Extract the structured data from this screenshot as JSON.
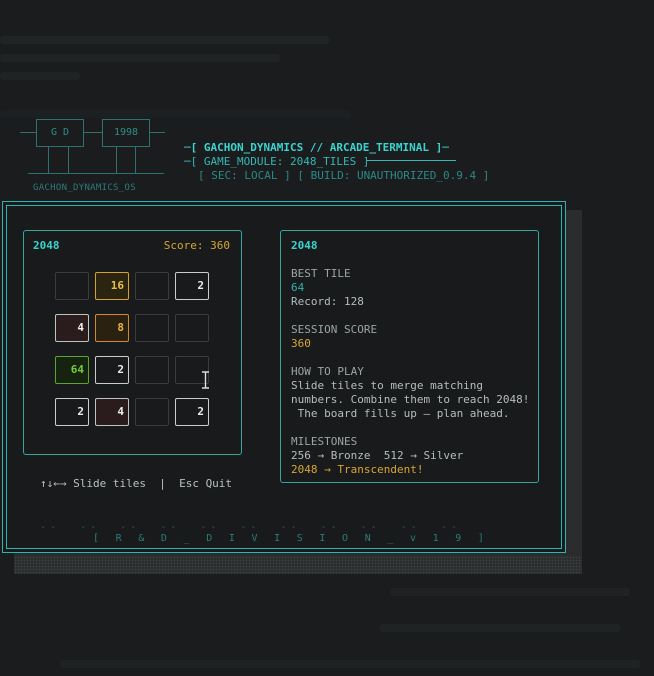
{
  "header": {
    "logo_left": "G  D",
    "logo_right": "1998",
    "logo_caption": "GACHON_DYNAMICS_OS",
    "line1": "─[ GACHON_DYNAMICS // ARCADE_TERMINAL ]─",
    "line2": "─[ GAME_MODULE: 2048_TILES ]",
    "line3": "[ SEC: LOCAL ] [ BUILD: UNAUTHORIZED_0.9.4 ]"
  },
  "game": {
    "title": "2048",
    "score_label": "Score: 360",
    "board": [
      [
        "",
        "16",
        "",
        "2"
      ],
      [
        "4",
        "8",
        "",
        ""
      ],
      [
        "64",
        "2",
        "",
        ""
      ],
      [
        "2",
        "4",
        "",
        "2"
      ]
    ],
    "controls": "↑↓←→ Slide tiles  |  Esc Quit"
  },
  "info": {
    "title": "2048",
    "best_tile_label": "BEST TILE",
    "best_tile_value": "64",
    "record": "Record: 128",
    "session_label": "SESSION SCORE",
    "session_value": "360",
    "how_label": "HOW TO PLAY",
    "how_1": "Slide tiles to merge matching",
    "how_2": "numbers. Combine them to reach 2048!",
    "how_3": " The board fills up — plan ahead.",
    "milestones_label": "MILESTONES",
    "milestone_1": "256 → Bronze  512 → Silver",
    "milestone_2": "2048 → Transcendent!"
  },
  "footer": {
    "dashes": "--  --  --  --  --  --  --  --  --  --  --",
    "label": "[ R & D _ D I V I S I O N _ v 1 9 ]"
  },
  "colors": {
    "accent": "#2fb3b0",
    "score": "#d8a536",
    "tile_64": "#78cc3c"
  }
}
